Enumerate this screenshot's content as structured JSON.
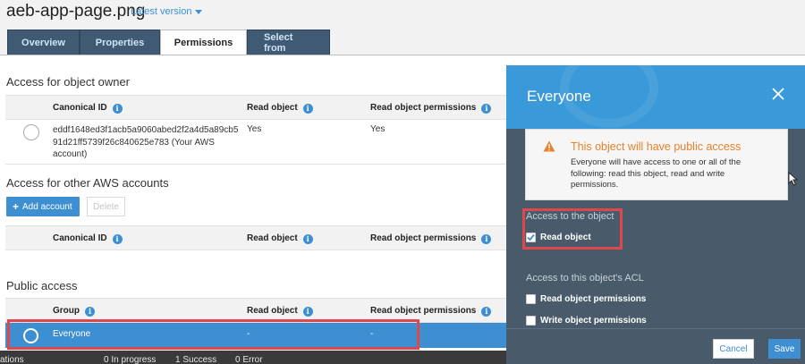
{
  "header": {
    "file_name": "aeb-app-page.png",
    "version_label": "Latest version",
    "tabs": [
      {
        "label": "Overview"
      },
      {
        "label": "Properties"
      },
      {
        "label": "Permissions"
      },
      {
        "label": "Select from"
      }
    ],
    "active_tab": "Permissions"
  },
  "owner_section": {
    "title": "Access for object owner",
    "columns": [
      "Canonical ID",
      "Read object",
      "Read object permissions"
    ],
    "row": {
      "canonical_id_line1": "eddf1648ed3f1acb5a9060abed2f2a4d5a89cb5",
      "canonical_id_line2": "91d21ff5739f26c840625e783 (Your AWS",
      "canonical_id_line3": "account)",
      "read_object": "Yes",
      "read_object_permissions": "Yes"
    }
  },
  "other_accounts_section": {
    "title": "Access for other AWS accounts",
    "add_button": "Add account",
    "delete_button": "Delete",
    "columns": [
      "Canonical ID",
      "Read object",
      "Read object permissions"
    ]
  },
  "public_section": {
    "title": "Public access",
    "columns": [
      "Group",
      "Read object",
      "Read object permissions"
    ],
    "row": {
      "group": "Everyone",
      "read_object": "-",
      "read_object_permissions": "-"
    }
  },
  "status_bar": {
    "operations": "ations",
    "in_progress": "0 In progress",
    "success": "1 Success",
    "error": "0 Error"
  },
  "panel": {
    "title": "Everyone",
    "warning": {
      "title": "This object will have public access",
      "text": "Everyone will have access to one or all of the following: read this object, read and write permissions."
    },
    "access_object_label": "Access to the object",
    "read_object_label": "Read object",
    "read_object_checked": true,
    "acl_label": "Access to this object's ACL",
    "read_permissions_label": "Read object permissions",
    "read_permissions_checked": false,
    "write_permissions_label": "Write object permissions",
    "write_permissions_checked": false,
    "cancel_button": "Cancel",
    "save_button": "Save"
  },
  "colors": {
    "accent": "#3d8fd1",
    "panel_bg": "#495b6b",
    "panel_header": "#3a9ad9",
    "warning": "#e8812b",
    "highlight": "#e0474c"
  },
  "icons": {
    "info": "info-icon",
    "close": "close-icon",
    "warning": "warning-triangle-icon",
    "checkbox": "checkmark-icon",
    "cursor": "mouse-cursor-icon"
  }
}
